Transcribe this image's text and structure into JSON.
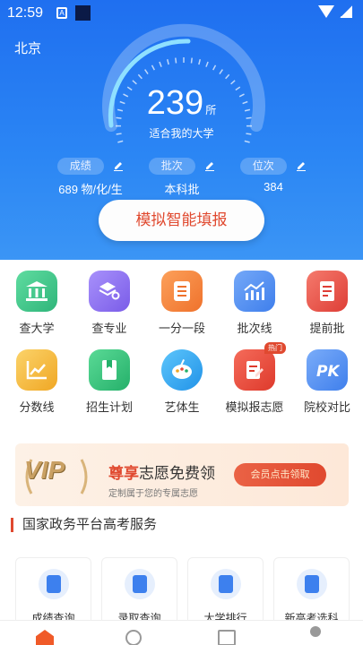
{
  "status_bar": {
    "time": "12:59",
    "notif_a": "A"
  },
  "header": {
    "city": "北京",
    "count": "239",
    "count_unit": "所",
    "count_caption": "适合我的大学",
    "stats": [
      {
        "label": "成绩",
        "value": "689 物/化/生"
      },
      {
        "label": "批次",
        "value": "本科批"
      },
      {
        "label": "位次",
        "value": "384"
      }
    ],
    "cta_label": "模拟智能填报"
  },
  "features": [
    {
      "label": "查大学",
      "icon": "university-icon",
      "color": "#3cc48a"
    },
    {
      "label": "查专业",
      "icon": "major-search-icon",
      "color": "#8f74f0"
    },
    {
      "label": "一分一段",
      "icon": "score-list-icon",
      "color": "#f58a3a"
    },
    {
      "label": "批次线",
      "icon": "trend-chart-icon",
      "color": "#4f8ff0"
    },
    {
      "label": "提前批",
      "icon": "document-icon",
      "color": "#e9524a"
    },
    {
      "label": "分数线",
      "icon": "line-chart-icon",
      "color": "#f4b73a"
    },
    {
      "label": "招生计划",
      "icon": "book-icon",
      "color": "#38c580"
    },
    {
      "label": "艺体生",
      "icon": "palette-icon",
      "color": "#3aa7f0"
    },
    {
      "label": "模拟报志愿",
      "icon": "form-edit-icon",
      "color": "#e84a3a",
      "badge": "热门"
    },
    {
      "label": "院校对比",
      "icon": "pk-icon",
      "color": "#4f8ff0"
    }
  ],
  "banner": {
    "vip_text": "VIP",
    "title_red": "尊享",
    "title_rest": "志愿免费领",
    "subtitle": "定制属于您的专属志愿",
    "button": "会员点击领取"
  },
  "service": {
    "title": "国家政务平台高考服务",
    "cards": [
      {
        "label": "成绩查询"
      },
      {
        "label": "录取查询"
      },
      {
        "label": "大学排行"
      },
      {
        "label": "新高考选科"
      }
    ]
  }
}
